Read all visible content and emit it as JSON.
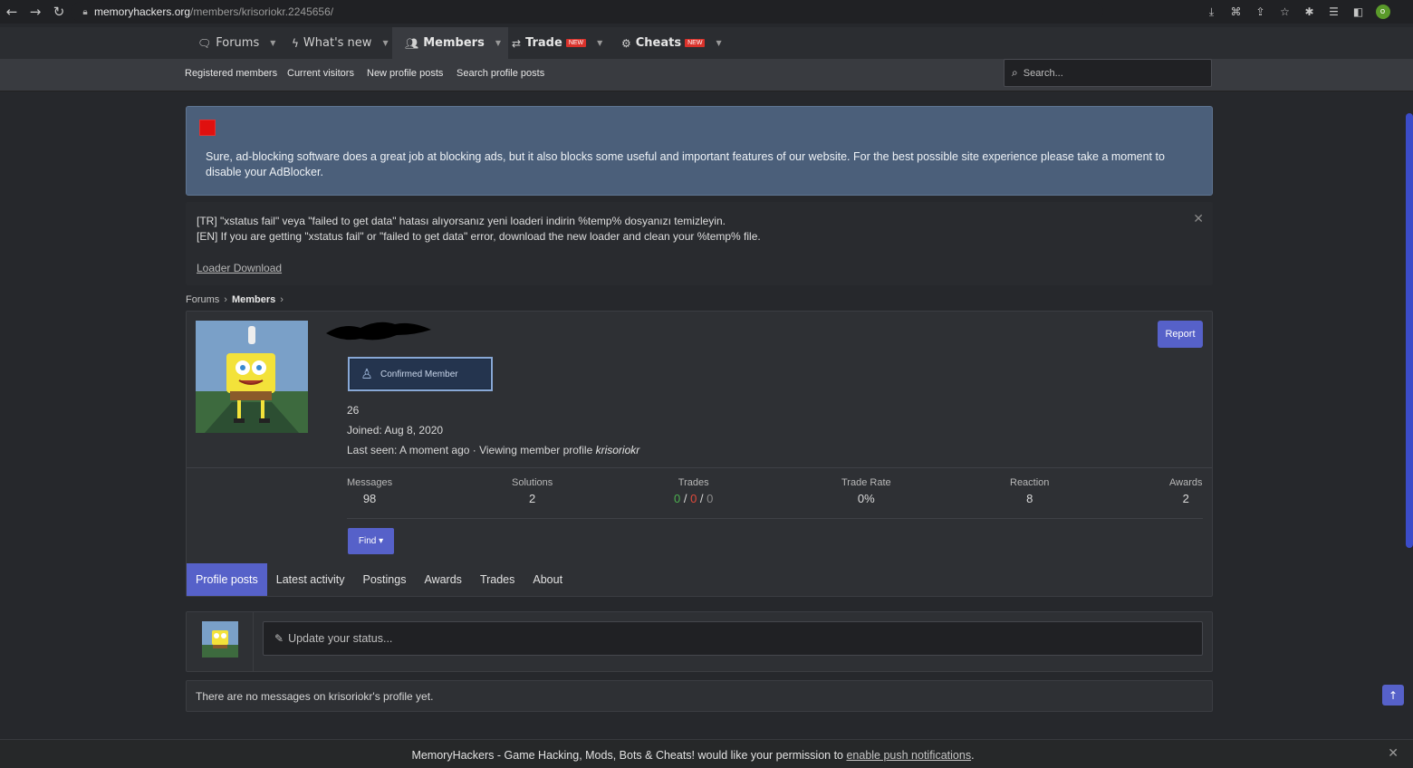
{
  "browser": {
    "url_host": "memoryhackers.org",
    "url_path": "/members/krisoriokr.2245656/"
  },
  "topnav": {
    "tabs": [
      {
        "label": "Forums",
        "icon": "comments-icon"
      },
      {
        "label": "What's new",
        "icon": "bolt-icon"
      },
      {
        "label": "Members",
        "icon": "users-icon"
      },
      {
        "label": "Trade",
        "icon": "exchange-icon",
        "badge": "NEW"
      },
      {
        "label": "Cheats",
        "icon": "gear-icon",
        "badge": "NEW"
      }
    ]
  },
  "subnav": {
    "links": [
      "Registered members",
      "Current visitors",
      "New profile posts",
      "Search profile posts"
    ],
    "search_placeholder": "Search..."
  },
  "adblock_notice": {
    "text": "Sure, ad-blocking software does a great job at blocking ads, but it also blocks some useful and important features of our website. For the best possible site experience please take a moment to disable your AdBlocker."
  },
  "announcement": {
    "line_tr": "[TR] \"xstatus fail\" veya \"failed to get data\" hatası alıyorsanız yeni loaderi indirin %temp% dosyanızı temizleyin.",
    "line_en": "[EN] If you are getting \"xstatus fail\" or \"failed to get data\" error, download the new loader and clean your %temp% file.",
    "link": "Loader Download"
  },
  "breadcrumb": {
    "items": [
      "Forums",
      "Members"
    ]
  },
  "profile": {
    "banner": "Confirmed Member",
    "number": "26",
    "joined": "Joined: Aug 8, 2020",
    "last_seen_prefix": "Last seen: A moment ago · Viewing member profile ",
    "last_seen_name": "krisoriokr",
    "report_label": "Report",
    "find_label": "Find ▾",
    "stats": [
      {
        "label": "Messages",
        "value": "98"
      },
      {
        "label": "Solutions",
        "value": "2"
      },
      {
        "label": "Trades",
        "positive": "0",
        "negative": "0",
        "neutral": "0"
      },
      {
        "label": "Trade Rate",
        "value": "0%"
      },
      {
        "label": "Reaction",
        "value": "8"
      },
      {
        "label": "Awards",
        "value": "2"
      }
    ],
    "tabs": [
      "Profile posts",
      "Latest activity",
      "Postings",
      "Awards",
      "Trades",
      "About"
    ]
  },
  "status_box": {
    "placeholder": "Update your status..."
  },
  "no_messages": "There are no messages on krisoriokr's profile yet.",
  "push_bar": {
    "text": "MemoryHackers - Game Hacking, Mods, Bots & Cheats! would like your permission to ",
    "link": "enable push notifications",
    "suffix": "."
  },
  "colors": {
    "accent": "#5661c9",
    "notice_bg": "#4b5f7a",
    "positive": "#4caf50",
    "negative": "#e04a3b"
  }
}
